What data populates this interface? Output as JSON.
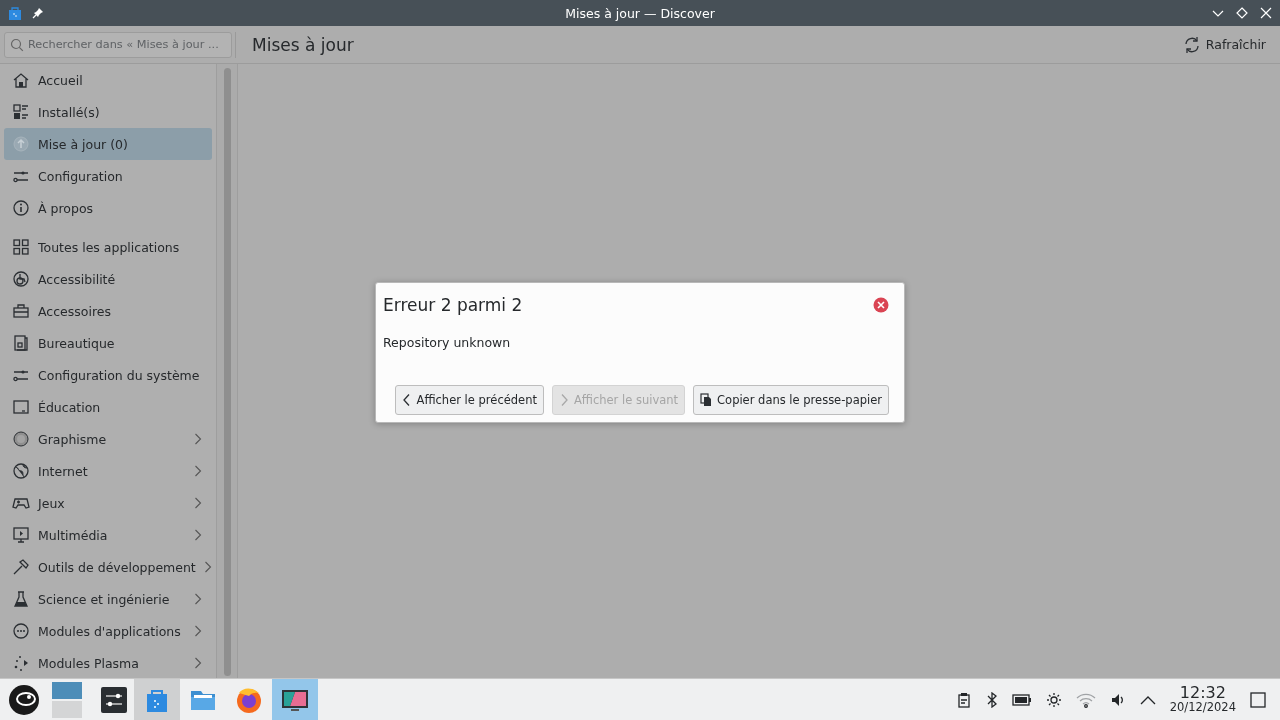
{
  "window": {
    "title": "Mises à jour — Discover"
  },
  "toolbar": {
    "search": {
      "placeholder": "Rechercher dans « Mises à jour ..."
    },
    "page_title": "Mises à jour",
    "refresh_button": "Rafraîchir"
  },
  "sidebar": {
    "sections": [
      {
        "items": [
          {
            "label": "Accueil",
            "selected": false,
            "expandable": false
          },
          {
            "label": "Installé(s)",
            "selected": false,
            "expandable": false
          },
          {
            "label": "Mise à jour (0)",
            "selected": true,
            "expandable": false
          },
          {
            "label": "Configuration",
            "selected": false,
            "expandable": false
          },
          {
            "label": "À propos",
            "selected": false,
            "expandable": false
          }
        ]
      },
      {
        "items": [
          {
            "label": "Toutes les applications",
            "selected": false,
            "expandable": false
          },
          {
            "label": "Accessibilité",
            "selected": false,
            "expandable": false
          },
          {
            "label": "Accessoires",
            "selected": false,
            "expandable": false
          },
          {
            "label": "Bureautique",
            "selected": false,
            "expandable": false
          },
          {
            "label": "Configuration du système",
            "selected": false,
            "expandable": false
          },
          {
            "label": "Éducation",
            "selected": false,
            "expandable": false
          },
          {
            "label": "Graphisme",
            "selected": false,
            "expandable": true
          },
          {
            "label": "Internet",
            "selected": false,
            "expandable": true
          },
          {
            "label": "Jeux",
            "selected": false,
            "expandable": true
          },
          {
            "label": "Multimédia",
            "selected": false,
            "expandable": true
          },
          {
            "label": "Outils de développement",
            "selected": false,
            "expandable": true
          },
          {
            "label": "Science et ingénierie",
            "selected": false,
            "expandable": true
          },
          {
            "label": "Modules d'applications",
            "selected": false,
            "expandable": true
          },
          {
            "label": "Modules Plasma",
            "selected": false,
            "expandable": true
          }
        ]
      }
    ]
  },
  "dialog": {
    "title": "Erreur 2 parmi 2",
    "message": "Repository unknown",
    "buttons": [
      {
        "kind": "previous",
        "label": "Afficher le précédent",
        "disabled": false
      },
      {
        "kind": "next",
        "label": "Afficher le suivant",
        "disabled": true
      },
      {
        "kind": "copy",
        "label": "Copier dans le presse-papier",
        "disabled": false
      }
    ]
  },
  "taskbar": {
    "desktops": [
      {
        "selected": true
      },
      {
        "selected": false
      }
    ],
    "tasks": [
      {
        "selected": true,
        "hovered": false
      },
      {
        "selected": false,
        "hovered": false
      },
      {
        "selected": false,
        "hovered": false
      },
      {
        "selected": false,
        "hovered": true
      }
    ],
    "clock": {
      "time": "12:32",
      "date": "20/12/2024"
    }
  }
}
